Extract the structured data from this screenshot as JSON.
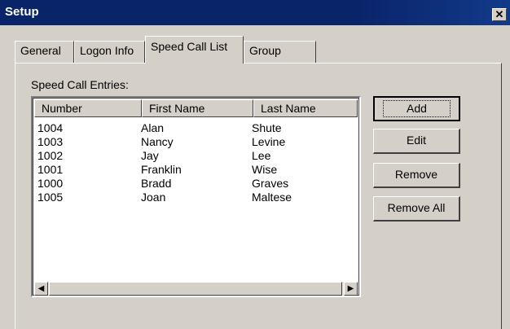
{
  "window": {
    "title": "Setup",
    "close_glyph": "✕"
  },
  "tabs": [
    {
      "label": "General"
    },
    {
      "label": "Logon Info"
    },
    {
      "label": "Speed Call List"
    },
    {
      "label": "Group"
    }
  ],
  "list": {
    "caption": "Speed Call Entries:",
    "columns": [
      "Number",
      "First Name",
      "Last Name"
    ],
    "rows": [
      [
        "1004",
        "Alan",
        "Shute"
      ],
      [
        "1003",
        "Nancy",
        "Levine"
      ],
      [
        "1002",
        "Jay",
        "Lee"
      ],
      [
        "1001",
        "Franklin",
        "Wise"
      ],
      [
        "1000",
        "Bradd",
        "Graves"
      ],
      [
        "1005",
        "Joan",
        "Maltese"
      ]
    ],
    "scroll_left_glyph": "◀",
    "scroll_right_glyph": "▶"
  },
  "buttons": {
    "add": "Add",
    "edit": "Edit",
    "remove": "Remove",
    "remove_all": "Remove All"
  },
  "colors": {
    "titlebar": "#0a246a",
    "face": "#d4d0c8"
  }
}
